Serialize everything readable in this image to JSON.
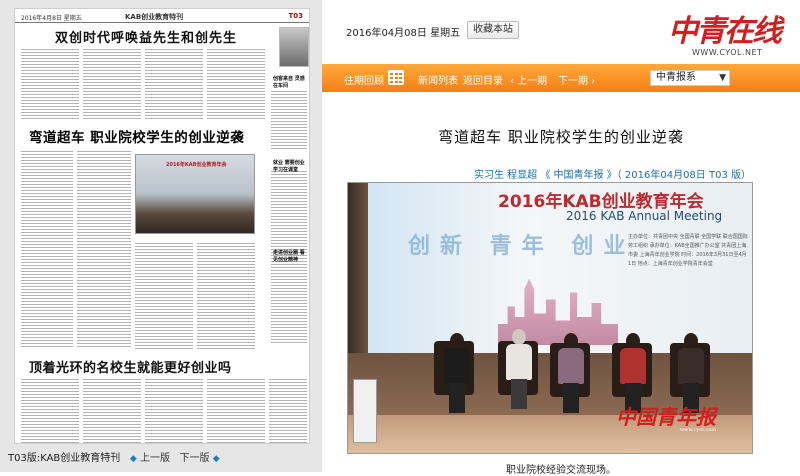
{
  "paper": {
    "header": {
      "date": "2016年4月8日 星期五",
      "section": "KAB创业教育特刊",
      "num": "T03"
    },
    "headline1": "双创时代呼唤益先生和创先生",
    "headline2": "弯道超车  职业院校学生的创业逆袭",
    "headline3": "顶着光环的名校生就能更好创业吗",
    "photo_caption": "2016年KAB创业教育年会",
    "side_titles": [
      "创客来自 灵感在车间",
      "就业 需要创业 学习在课堂",
      "走进创业圈 看见创业精神"
    ],
    "bottom": {
      "label": "T03版:KAB创业教育特刊",
      "prev": "上一版",
      "next": "下一版",
      "left_arrow": "◆",
      "right_arrow": "◆"
    }
  },
  "header": {
    "date": "2016年04月08日  星期五",
    "favorite": "收藏本站",
    "logo": "中青在线",
    "logo_url": "WWW.CYOL.NET"
  },
  "nav": {
    "items": [
      "往期回顾",
      "新闻列表",
      "返回目录",
      "‹ 上一期",
      "下一期 ›"
    ],
    "select_value": "中青报系",
    "caret": "▼"
  },
  "article": {
    "title": "弯道超车  职业院校学生的创业逆袭",
    "byline": "实习生  程显超  《 中国青年报 》（ 2016年04月08日  T03 版）",
    "photo": {
      "screen_title": "2016年KAB创业教育年会",
      "screen_subtitle": "2016 KAB Annual Meeting",
      "screen_words": "创新 青年 创业",
      "screen_info": "主办单位：共青团中央  全国青联  全国学联  联合国国际劳工组织 承办单位：KAB全国推广办公室  共青团上海市委  上海青年创业学院 时间：2016年3月31日至4月1日 地点：上海青年创业学院青年会堂",
      "watermark": "中国青年报",
      "watermark_url": "www.cyol.com"
    },
    "caption": "职业院校经验交流现场。"
  }
}
